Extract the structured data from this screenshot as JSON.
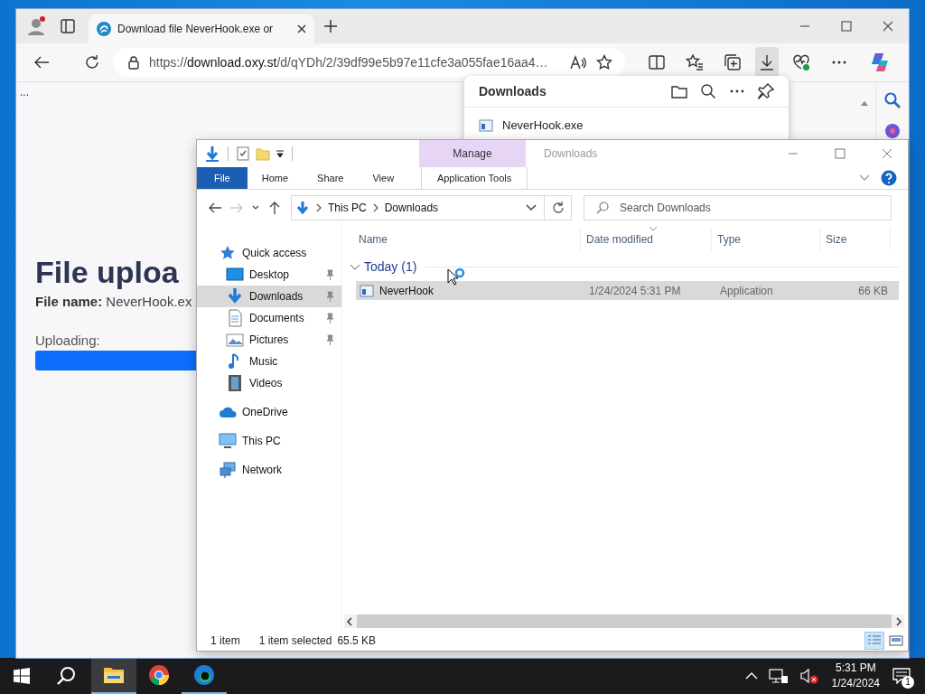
{
  "browser": {
    "tab": {
      "title": "Download file NeverHook.exe or",
      "selected": true
    },
    "url": {
      "scheme": "https://",
      "host": "download.oxy.st",
      "path": "/d/qYDh/2/39df99e5b97e11cfe3a055fae16aa4…"
    },
    "downloads_panel": {
      "title": "Downloads",
      "items": [
        {
          "name": "NeverHook.exe"
        }
      ]
    },
    "page": {
      "ellipsis": "...",
      "heading": "File uploa",
      "file_label": "File name:",
      "file_name": "NeverHook.ex",
      "status": "Uploading:"
    }
  },
  "explorer": {
    "title": "Downloads",
    "context_group": "Manage",
    "ribbon_tabs": [
      {
        "label": "File",
        "kind": "file"
      },
      {
        "label": "Home",
        "kind": "normal"
      },
      {
        "label": "Share",
        "kind": "normal"
      },
      {
        "label": "View",
        "kind": "normal"
      },
      {
        "label": "Application Tools",
        "kind": "context"
      }
    ],
    "breadcrumb": [
      "This PC",
      "Downloads"
    ],
    "search": {
      "placeholder": "Search Downloads"
    },
    "nav": [
      {
        "label": "Quick access",
        "kind": "star",
        "selected": false,
        "children": [
          {
            "label": "Desktop",
            "kind": "desktop",
            "pinned": true,
            "selected": false
          },
          {
            "label": "Downloads",
            "kind": "downloads",
            "pinned": true,
            "selected": true
          },
          {
            "label": "Documents",
            "kind": "documents",
            "pinned": true,
            "selected": false
          },
          {
            "label": "Pictures",
            "kind": "pictures",
            "pinned": true,
            "selected": false
          },
          {
            "label": "Music",
            "kind": "music",
            "pinned": false,
            "selected": false
          },
          {
            "label": "Videos",
            "kind": "videos",
            "pinned": false,
            "selected": false
          }
        ]
      },
      {
        "label": "OneDrive",
        "kind": "cloud",
        "selected": false
      },
      {
        "label": "This PC",
        "kind": "pc",
        "selected": false
      },
      {
        "label": "Network",
        "kind": "network",
        "selected": false
      }
    ],
    "columns": [
      "Name",
      "Date modified",
      "Type",
      "Size"
    ],
    "groups": [
      {
        "label": "Today (1)",
        "expanded": true,
        "rows": [
          {
            "cells": [
              "NeverHook",
              "1/24/2024 5:31 PM",
              "Application",
              "66 KB"
            ],
            "selected": true
          }
        ]
      }
    ],
    "status_bar": {
      "count": "1 item",
      "selection": "1 item selected",
      "size": "65.5 KB"
    },
    "view_buttons": [
      {
        "kind": "details",
        "selected": true
      },
      {
        "kind": "large-icons",
        "selected": false
      }
    ]
  },
  "taskbar": {
    "apps": [
      {
        "kind": "explorer",
        "active": true,
        "running": true
      },
      {
        "kind": "chrome",
        "active": false,
        "running": false
      },
      {
        "kind": "edge",
        "active": false,
        "running": true
      }
    ],
    "time": "5:31 PM",
    "date": "1/24/2024",
    "notifications": "1"
  }
}
